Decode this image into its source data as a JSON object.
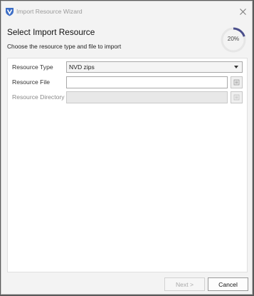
{
  "window": {
    "title": "Import Resource Wizard",
    "icon": "shield-logo-icon",
    "close_icon": "close-icon"
  },
  "page": {
    "heading": "Select Import Resource",
    "subheading": "Choose the resource type and file to import",
    "progress_label": "20%",
    "progress_value": 0.2,
    "progress_color": "#4b4f8c"
  },
  "form": {
    "resource_type": {
      "label": "Resource Type",
      "value": "NVD zips"
    },
    "resource_file": {
      "label": "Resource File",
      "value": ""
    },
    "resource_directory": {
      "label": "Resource Directory",
      "value": ""
    }
  },
  "footer": {
    "next_label": "Next >",
    "cancel_label": "Cancel"
  }
}
